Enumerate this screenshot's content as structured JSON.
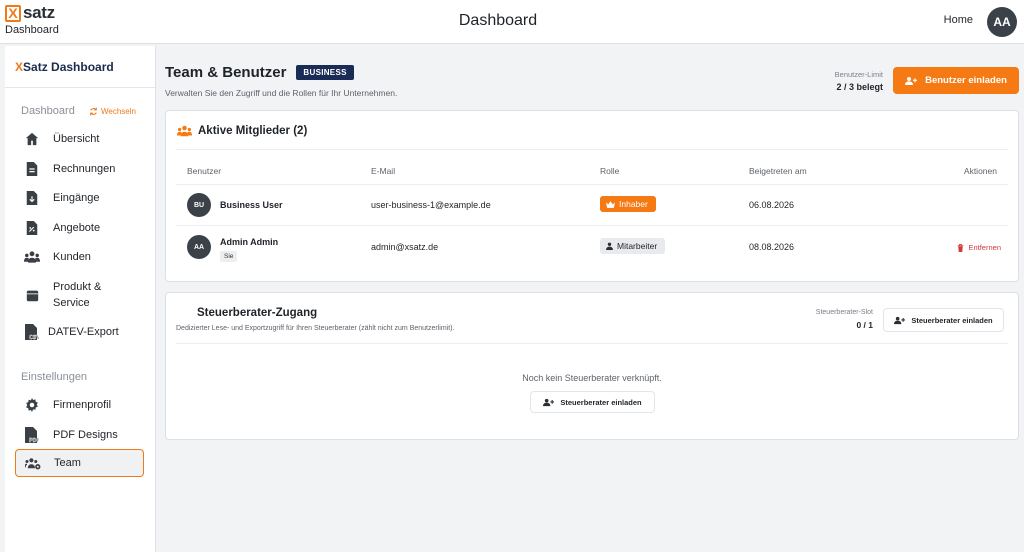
{
  "topbar": {
    "logo_x": "X",
    "logo_word": "satz",
    "logo_sub": "Dashboard",
    "title": "Dashboard",
    "home_link": "Home",
    "avatar": "AA"
  },
  "sidebar": {
    "brand_x": "X",
    "brand_rest": "Satz Dashboard",
    "section_dashboard": "Dashboard",
    "switch_label": "Wechseln",
    "items": [
      {
        "label": "Übersicht",
        "icon": "home-icon"
      },
      {
        "label": "Rechnungen",
        "icon": "document-icon"
      },
      {
        "label": "Eingänge",
        "icon": "download-document-icon"
      },
      {
        "label": "Angebote",
        "icon": "quote-document-icon"
      },
      {
        "label": "Kunden",
        "icon": "users-icon"
      },
      {
        "label": "Produkt &",
        "label2": "Service",
        "icon": "box-icon"
      },
      {
        "label": "DATEV-Export",
        "icon": "csv-file-icon"
      }
    ],
    "section_settings": "Einstellungen",
    "settings_items": [
      {
        "label": "Firmenprofil",
        "icon": "gear-icon"
      },
      {
        "label": "PDF Designs",
        "icon": "pdf-file-icon"
      },
      {
        "label": "Team",
        "icon": "team-settings-icon"
      }
    ],
    "active_item": "Team"
  },
  "header": {
    "title": "Team & Benutzer",
    "plan_badge": "BUSINESS",
    "subtitle": "Verwalten Sie den Zugriff und die Rollen für Ihr Unternehmen.",
    "limit_label": "Benutzer-Limit",
    "limit_value": "2 / 3 belegt",
    "invite_button": "Benutzer einladen"
  },
  "members": {
    "title": "Aktive Mitglieder (2)",
    "columns": [
      "Benutzer",
      "E-Mail",
      "Rolle",
      "Beigetreten am",
      "Aktionen"
    ],
    "rows": [
      {
        "initials": "BU",
        "name": "Business User",
        "you": "",
        "email": "user-business-1@example.de",
        "role": "Inhaber",
        "joined": "06.08.2026",
        "action": ""
      },
      {
        "initials": "AA",
        "name": "Admin Admin",
        "you": "Sie",
        "email": "admin@xsatz.de",
        "role": "Mitarbeiter",
        "joined": "08.08.2026",
        "action": "Entfernen"
      }
    ]
  },
  "advisor": {
    "title": "Steuerberater-Zugang",
    "subtitle": "Dedizierter Lese- und Exportzugriff für Ihren Steuerberater (zählt nicht zum Benutzerlimit).",
    "slot_label": "Steuerberater-Slot",
    "slot_value": "0 / 1",
    "invite_button": "Steuerberater einladen",
    "empty_text": "Noch kein Steuerberater verknüpft.",
    "empty_button": "Steuerberater einladen"
  },
  "colors": {
    "accent": "#f57a14",
    "navy": "#1a2b55",
    "danger": "#d23a3a"
  }
}
